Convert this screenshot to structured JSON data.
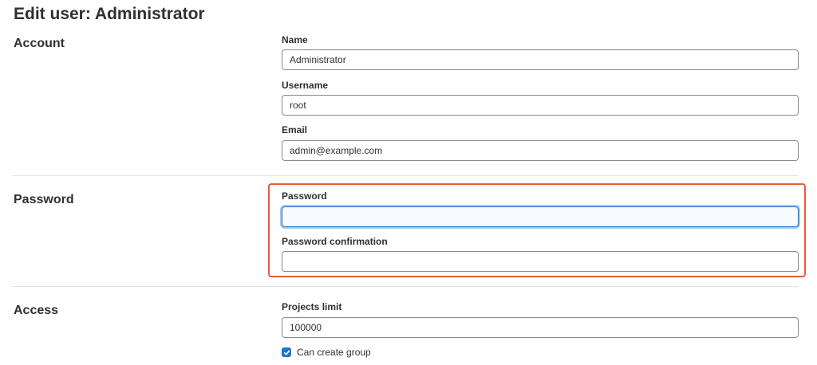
{
  "page": {
    "title": "Edit user: Administrator"
  },
  "account": {
    "heading": "Account",
    "name_label": "Name",
    "name_value": "Administrator",
    "username_label": "Username",
    "username_value": "root",
    "email_label": "Email",
    "email_value": "admin@example.com"
  },
  "password": {
    "heading": "Password",
    "password_label": "Password",
    "password_value": "",
    "confirmation_label": "Password confirmation",
    "confirmation_value": ""
  },
  "access": {
    "heading": "Access",
    "projects_limit_label": "Projects limit",
    "projects_limit_value": "100000",
    "can_create_group_label": "Can create group",
    "can_create_group_checked": true
  },
  "colors": {
    "focus_border": "#1f75cb",
    "highlight_border": "#ec5941",
    "checkbox_fill": "#1f75cb"
  }
}
